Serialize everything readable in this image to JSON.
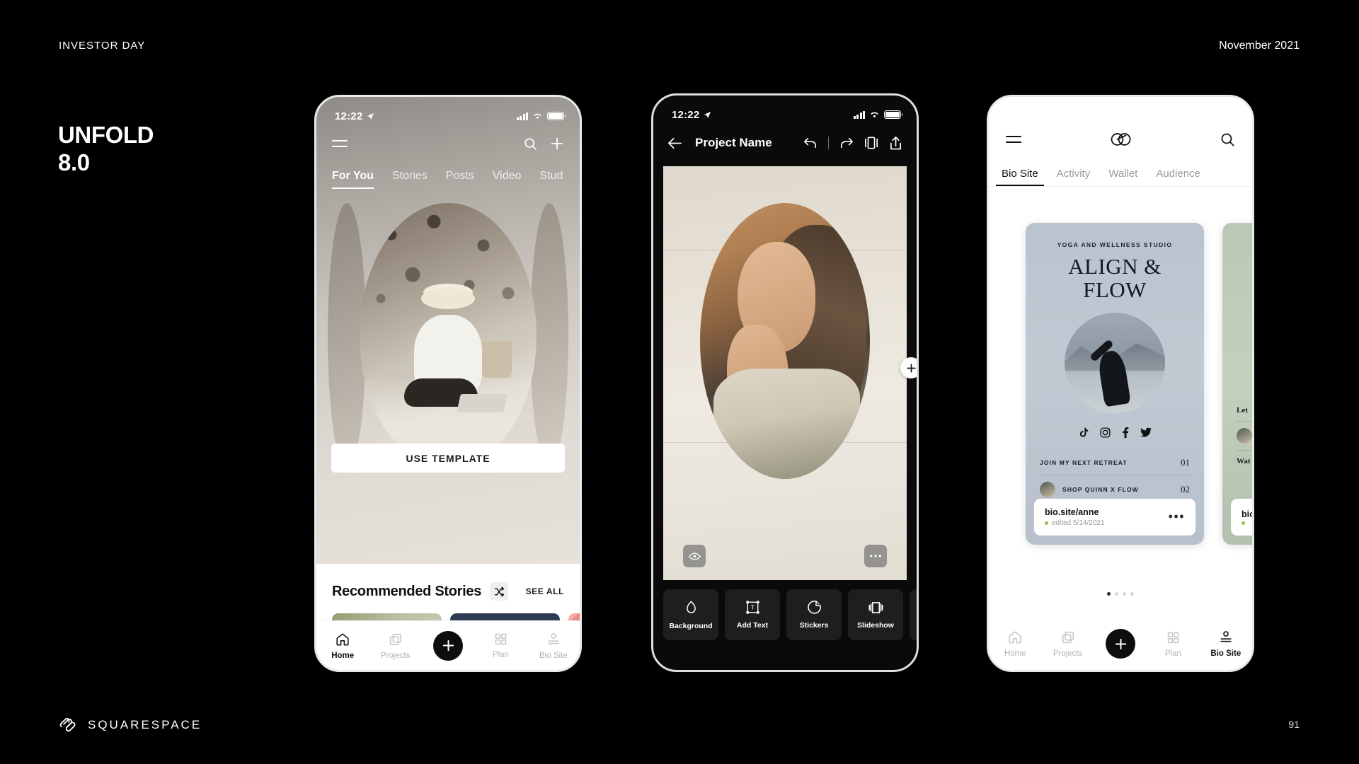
{
  "slide": {
    "kicker": "INVESTOR DAY",
    "date": "November 2021",
    "title_line1": "UNFOLD",
    "title_line2": "8.0",
    "brand": "SQUARESPACE",
    "page_number": "91"
  },
  "phone1": {
    "status": {
      "time": "12:22",
      "location_icon": "location-arrow-icon"
    },
    "menu_icon": "hamburger-menu-icon",
    "search_icon": "search-icon",
    "add_icon": "plus-icon",
    "tabs": [
      {
        "label": "For You",
        "active": true
      },
      {
        "label": "Stories",
        "active": false
      },
      {
        "label": "Posts",
        "active": false
      },
      {
        "label": "Video",
        "active": false
      },
      {
        "label": "Stud",
        "active": false
      }
    ],
    "use_template_label": "USE TEMPLATE",
    "recommended_title": "Recommended Stories",
    "shuffle_icon": "shuffle-icon",
    "see_all_label": "SEE ALL",
    "thumbs": [
      "story-thumb-landscape",
      "story-thumb-portrait",
      "story-thumb-pattern"
    ],
    "nav": [
      {
        "label": "Home",
        "icon": "home-icon",
        "active": true
      },
      {
        "label": "Projects",
        "icon": "projects-icon",
        "active": false
      },
      {
        "label": "",
        "icon": "plus-icon",
        "active": false
      },
      {
        "label": "Plan",
        "icon": "grid-icon",
        "active": false
      },
      {
        "label": "Bio Site",
        "icon": "bio-site-icon",
        "active": false
      }
    ]
  },
  "phone2": {
    "status": {
      "time": "12:22",
      "location_icon": "location-arrow-icon"
    },
    "back_icon": "back-arrow-icon",
    "title": "Project Name",
    "tools": [
      "undo-icon",
      "redo-icon",
      "flip-icon",
      "share-icon"
    ],
    "add_element_icon": "plus-icon",
    "preview_icon": "eye-icon",
    "more_icon": "more-horizontal-icon",
    "toolbar": [
      {
        "label": "Background",
        "icon": "droplet-icon"
      },
      {
        "label": "Add Text",
        "icon": "add-text-icon"
      },
      {
        "label": "Stickers",
        "icon": "stickers-icon"
      },
      {
        "label": "Slideshow",
        "icon": "slideshow-icon"
      }
    ]
  },
  "phone3": {
    "menu_icon": "hamburger-menu-icon",
    "logo_icon": "unfold-logo-icon",
    "search_icon": "search-icon",
    "tabs": [
      {
        "label": "Bio Site",
        "active": true
      },
      {
        "label": "Activity",
        "active": false
      },
      {
        "label": "Wallet",
        "active": false
      },
      {
        "label": "Audience",
        "active": false
      }
    ],
    "card_main": {
      "kicker": "YOGA AND WELLNESS STUDIO",
      "title_line1": "ALIGN &",
      "title_line2": "FLOW",
      "socials": [
        "tiktok-icon",
        "instagram-icon",
        "facebook-icon",
        "twitter-icon"
      ],
      "links": [
        {
          "label": "JOIN MY NEXT RETREAT",
          "number": "01",
          "has_thumb": false
        },
        {
          "label": "SHOP QUINN X FLOW",
          "number": "02",
          "has_thumb": true
        }
      ],
      "url": "bio.site/anne",
      "edited": "edited 5/14/2021",
      "more_icon": "more-horizontal-icon"
    },
    "card_next": {
      "link1": "Let",
      "link2": "Wat",
      "url": "bio"
    },
    "pager": {
      "count": 4,
      "active": 0
    },
    "nav": [
      {
        "label": "Home",
        "icon": "home-icon",
        "active": false
      },
      {
        "label": "Projects",
        "icon": "projects-icon",
        "active": false
      },
      {
        "label": "",
        "icon": "plus-icon",
        "active": false
      },
      {
        "label": "Plan",
        "icon": "grid-icon",
        "active": false
      },
      {
        "label": "Bio Site",
        "icon": "bio-site-icon",
        "active": true
      }
    ]
  }
}
